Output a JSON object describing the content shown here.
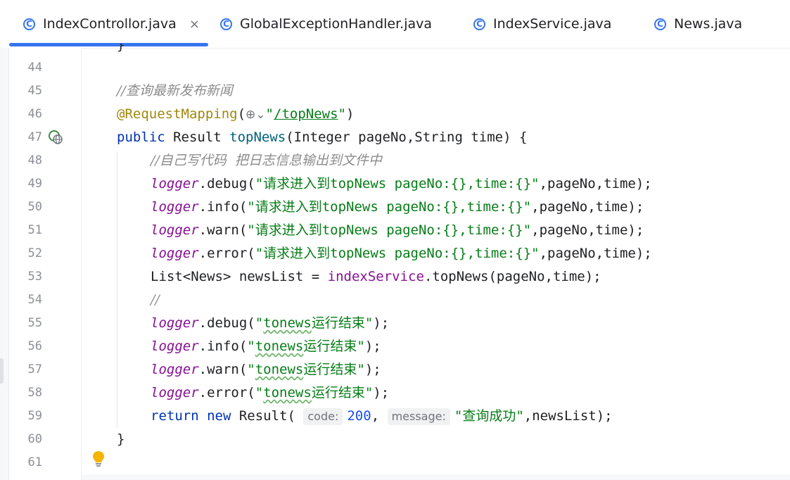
{
  "tabs": [
    {
      "label": "IndexControllor.java",
      "icon": "class-icon",
      "active": true,
      "close": "×"
    },
    {
      "label": "GlobalExceptionHandler.java",
      "icon": "class-icon",
      "active": false
    },
    {
      "label": "IndexService.java",
      "icon": "class-icon",
      "active": false
    },
    {
      "label": "News.java",
      "icon": "class-icon",
      "active": false
    }
  ],
  "tab_icon_glyph": "C",
  "accent_color": "#3574f0",
  "editor": {
    "top_partial": "}",
    "lines": [
      {
        "n": "44"
      },
      {
        "n": "45",
        "comment": "//查询最新发布新闻"
      },
      {
        "n": "46",
        "annotation": "@RequestMapping",
        "paren_open": "(",
        "globe": "⊕⌄",
        "q1": "\"",
        "path": "/topNews",
        "q2": "\"",
        "paren_close": ")"
      },
      {
        "n": "47",
        "kw": "public",
        "sig_a": " Result ",
        "method": "topNews",
        "sig_b": "(Integer pageNo,String time) {"
      },
      {
        "n": "48",
        "comment": "//自己写代码  把日志信息输出到文件中"
      },
      {
        "n": "49",
        "obj": "logger",
        "call": ".debug(",
        "str": "\"请求进入到topNews pageNo:{},time:{}\"",
        "rest": ",pageNo,time);"
      },
      {
        "n": "50",
        "obj": "logger",
        "call": ".info(",
        "str": "\"请求进入到topNews pageNo:{},time:{}\"",
        "rest": ",pageNo,time);"
      },
      {
        "n": "51",
        "obj": "logger",
        "call": ".warn(",
        "str": "\"请求进入到topNews pageNo:{},time:{}\"",
        "rest": ",pageNo,time);"
      },
      {
        "n": "52",
        "obj": "logger",
        "call": ".error(",
        "str": "\"请求进入到topNews pageNo:{},time:{}\"",
        "rest": ",pageNo,time);"
      },
      {
        "n": "53",
        "pre": "List<News> newsList = ",
        "field": "indexService",
        "post": ".topNews(pageNo,time);"
      },
      {
        "n": "54",
        "comment": "//"
      },
      {
        "n": "55",
        "obj": "logger",
        "call": ".debug(",
        "q1": "\"",
        "word": "tonews",
        "cn": "运行结束\"",
        "rest": ");"
      },
      {
        "n": "56",
        "obj": "logger",
        "call": ".info(",
        "q1": "\"",
        "word": "tonews",
        "cn": "运行结束\"",
        "rest": ");"
      },
      {
        "n": "57",
        "obj": "logger",
        "call": ".warn(",
        "q1": "\"",
        "word": "tonews",
        "cn": "运行结束\"",
        "rest": ");"
      },
      {
        "n": "58",
        "obj": "logger",
        "call": ".error(",
        "q1": "\"",
        "word": "tonews",
        "cn": "运行结束\"",
        "rest": ");"
      },
      {
        "n": "59",
        "kw": "return",
        "kw2": "new",
        "cls": " Result( ",
        "hint1": "code:",
        "num": "200",
        "comma": ", ",
        "hint2": "message:",
        "str": "\"查询成功\"",
        "rest": ",newsList);"
      },
      {
        "n": "60",
        "brace": "}"
      },
      {
        "n": "61"
      }
    ]
  },
  "colors": {
    "keyword": "#0033b3",
    "annotation": "#9e880d",
    "string": "#067d17",
    "field": "#871094",
    "method": "#00627a",
    "number": "#1750eb",
    "comment": "#8c8c8c"
  }
}
